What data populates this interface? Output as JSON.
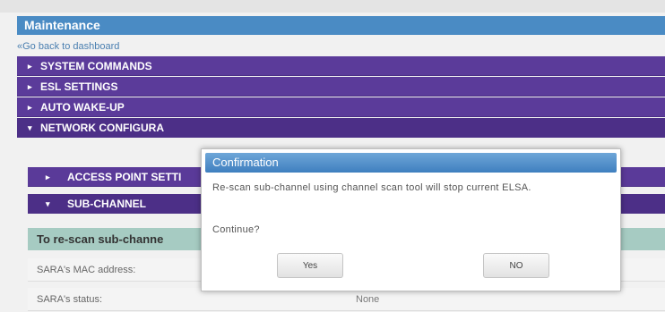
{
  "page": {
    "title": "Maintenance",
    "back_link": "Go back to dashboard",
    "back_icon": "«"
  },
  "sections": [
    {
      "label": "SYSTEM COMMANDS",
      "expanded": false
    },
    {
      "label": "ESL SETTINGS",
      "expanded": false
    },
    {
      "label": "AUTO WAKE-UP",
      "expanded": false
    },
    {
      "label": "NETWORK CONFIGURA",
      "expanded": true
    }
  ],
  "subsections": [
    {
      "label": "ACCESS POINT SETTI",
      "expanded": false
    },
    {
      "label": "SUB-CHANNEL",
      "expanded": true
    }
  ],
  "subchannel": {
    "heading": "To re-scan sub-channe",
    "fields": [
      {
        "label": "SARA's MAC address:",
        "value": ""
      },
      {
        "label": "SARA's status:",
        "value": "None"
      }
    ]
  },
  "icons": {
    "collapsed": "▸",
    "expanded": "▾"
  },
  "dialog": {
    "title": "Confirmation",
    "message": "Re-scan sub-channel using channel scan tool will stop current ELSA.",
    "question": "Continue?",
    "yes_label": "Yes",
    "no_label": "NO"
  },
  "colors": {
    "header": "#4a8bc4",
    "section": "#5b3b9a",
    "teal": "#a6cbc2"
  }
}
